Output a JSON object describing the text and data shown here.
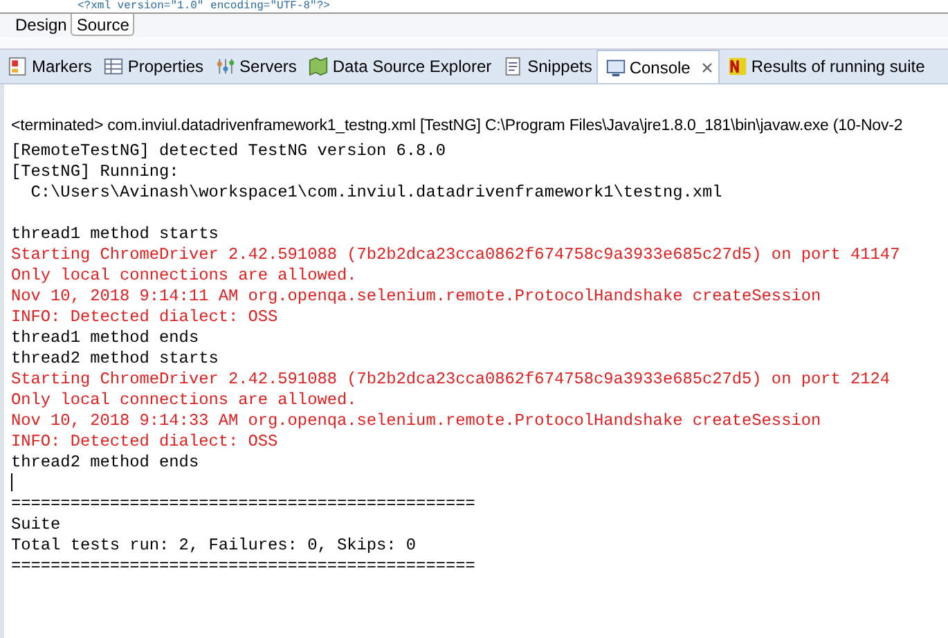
{
  "editor": {
    "source_line": "<?xml version=\"1.0\" encoding=\"UTF-8\"?>"
  },
  "editor_tabs": [
    {
      "label": "Design",
      "selected": false
    },
    {
      "label": "Source",
      "selected": true
    }
  ],
  "view_tabs": [
    {
      "label": "Markers",
      "selected": false,
      "closable": false
    },
    {
      "label": "Properties",
      "selected": false,
      "closable": false
    },
    {
      "label": "Servers",
      "selected": false,
      "closable": false
    },
    {
      "label": "Data Source Explorer",
      "selected": false,
      "closable": false
    },
    {
      "label": "Snippets",
      "selected": false,
      "closable": false
    },
    {
      "label": "Console",
      "selected": true,
      "closable": true
    },
    {
      "label": "Results of running suite",
      "selected": false,
      "closable": false
    }
  ],
  "console": {
    "status": "<terminated> com.inviul.datadrivenframework1_testng.xml [TestNG] C:\\Program Files\\Java\\jre1.8.0_181\\bin\\javaw.exe (10-Nov-2",
    "lines": [
      {
        "kind": "out",
        "text": "[RemoteTestNG] detected TestNG version 6.8.0"
      },
      {
        "kind": "out",
        "text": "[TestNG] Running:"
      },
      {
        "kind": "out",
        "text": "  C:\\Users\\Avinash\\workspace1\\com.inviul.datadrivenframework1\\testng.xml"
      },
      {
        "kind": "blank"
      },
      {
        "kind": "out",
        "text": "thread1 method starts"
      },
      {
        "kind": "err",
        "text": "Starting ChromeDriver 2.42.591088 (7b2b2dca23cca0862f674758c9a3933e685c27d5) on port 41147"
      },
      {
        "kind": "err",
        "text": "Only local connections are allowed."
      },
      {
        "kind": "err",
        "text": "Nov 10, 2018 9:14:11 AM org.openqa.selenium.remote.ProtocolHandshake createSession"
      },
      {
        "kind": "err",
        "text": "INFO: Detected dialect: OSS"
      },
      {
        "kind": "out",
        "text": "thread1 method ends"
      },
      {
        "kind": "out",
        "text": "thread2 method starts"
      },
      {
        "kind": "err",
        "text": "Starting ChromeDriver 2.42.591088 (7b2b2dca23cca0862f674758c9a3933e685c27d5) on port 2124"
      },
      {
        "kind": "err",
        "text": "Only local connections are allowed."
      },
      {
        "kind": "err",
        "text": "Nov 10, 2018 9:14:33 AM org.openqa.selenium.remote.ProtocolHandshake createSession"
      },
      {
        "kind": "err",
        "text": "INFO: Detected dialect: OSS"
      },
      {
        "kind": "out",
        "text": "thread2 method ends"
      },
      {
        "kind": "cursor"
      },
      {
        "kind": "out",
        "text": "==============================================="
      },
      {
        "kind": "out",
        "text": "Suite"
      },
      {
        "kind": "out",
        "text": "Total tests run: 2, Failures: 0, Skips: 0"
      },
      {
        "kind": "out",
        "text": "==============================================="
      }
    ]
  }
}
